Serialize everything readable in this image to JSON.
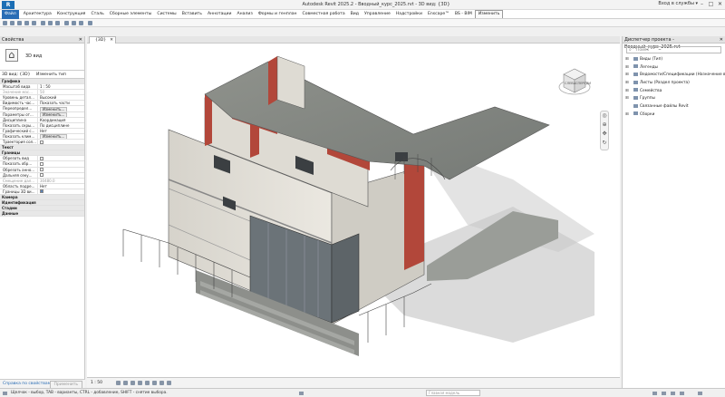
{
  "window": {
    "app_badge": "R",
    "title": "Autodesk Revit 2025.2 - Вводный_курс_2025.rvt - 3D вид: {3D}",
    "signin": "Вход в службы ▾",
    "minimize": "–",
    "maximize": "□",
    "close": "✕"
  },
  "ribbon": {
    "file": "Файл",
    "tabs": [
      "Архитектура",
      "Конструкция",
      "Сталь",
      "Сборные элементы",
      "Системы",
      "Вставить",
      "Аннотации",
      "Анализ",
      "Формы и генплан",
      "Совместная работа",
      "Вид",
      "Управление",
      "Надстройки",
      "Enscape™",
      "BS - BIM"
    ],
    "active_tab": "Изменить"
  },
  "properties": {
    "header": "Свойства",
    "close": "✕",
    "type_name": "3D вид",
    "type_dropdown": "3D вид: {3D}",
    "edit_type": "Изменить тип",
    "rows": [
      {
        "k": "Графика",
        "v": "",
        "cat": true
      },
      {
        "k": "Масштаб вида",
        "v": "1 : 50"
      },
      {
        "k": "Значение мас...",
        "v": "50",
        "grey": true
      },
      {
        "k": "Уровень детал...",
        "v": "Высокий"
      },
      {
        "k": "Видимость час...",
        "v": "Показать части"
      },
      {
        "k": "Переопредел...",
        "v": "Изменить...",
        "btn": true
      },
      {
        "k": "Параметры от...",
        "v": "Изменить...",
        "btn": true
      },
      {
        "k": "Дисциплина",
        "v": "Координация"
      },
      {
        "k": "Показать скры...",
        "v": "По дисциплине"
      },
      {
        "k": "Графический с...",
        "v": "Нет"
      },
      {
        "k": "Показать клим...",
        "v": "Изменить...",
        "btn": true
      },
      {
        "k": "Траектория сол...",
        "v": "",
        "cb": "off"
      },
      {
        "k": "Текст",
        "v": "",
        "cat": true
      },
      {
        "k": "Границы",
        "v": "",
        "cat": true
      },
      {
        "k": "Обрезать вид",
        "v": "",
        "cb": "off"
      },
      {
        "k": "Показать обр...",
        "v": "",
        "cb": "off"
      },
      {
        "k": "Обрезать анно...",
        "v": "",
        "cb": "off"
      },
      {
        "k": "Дальняя секу...",
        "v": "",
        "cb": "off"
      },
      {
        "k": "Смещение дал...",
        "v": "30480.0",
        "grey": true
      },
      {
        "k": "Область подре...",
        "v": "Нет"
      },
      {
        "k": "Границы 3D ви...",
        "v": "",
        "cb": "on"
      },
      {
        "k": "Камера",
        "v": "",
        "cat": true
      },
      {
        "k": "Идентификация",
        "v": "",
        "cat": true
      },
      {
        "k": "Стадии",
        "v": "",
        "cat": true
      },
      {
        "k": "Данные",
        "v": "",
        "cat": true
      }
    ],
    "help_link": "Справка по свойствам",
    "apply": "Применить"
  },
  "view": {
    "tab_label": "{3D}",
    "tab_close": "✕",
    "scale": "1 : 50"
  },
  "viewcube": {
    "face": "СЛЕВА",
    "second_face": "СПЕРЕДИ"
  },
  "browser": {
    "header": "Диспетчер проекта - Вводный_курс_2025.rvt",
    "close": "✕",
    "search_placeholder": "Поиск",
    "search_icon": "⌕",
    "items": [
      {
        "label": "Виды (Тип)",
        "tog": "⊞"
      },
      {
        "label": "Легенды",
        "tog": "⊞"
      },
      {
        "label": "Ведомости/Спецификации (Назначение в...",
        "tog": "⊞"
      },
      {
        "label": "Листы (Раздел проекта)",
        "tog": "⊞"
      },
      {
        "label": "Семейства",
        "tog": "⊞"
      },
      {
        "label": "Группы",
        "tog": "⊞"
      },
      {
        "label": "Связанные файлы Revit",
        "tog": ""
      },
      {
        "label": "Сборки",
        "tog": "⊞"
      }
    ]
  },
  "status": {
    "message": "Щелчок - выбор, TAB - варианты, CTRL - добавление, SHIFT - снятие выбора.",
    "model": "Главная модель"
  },
  "colors": {
    "file_tab": "#2a6db5",
    "brick": "#b2473a",
    "roof": "#868a85",
    "wall": "#e7e4dc",
    "glass": "#6b7378"
  }
}
